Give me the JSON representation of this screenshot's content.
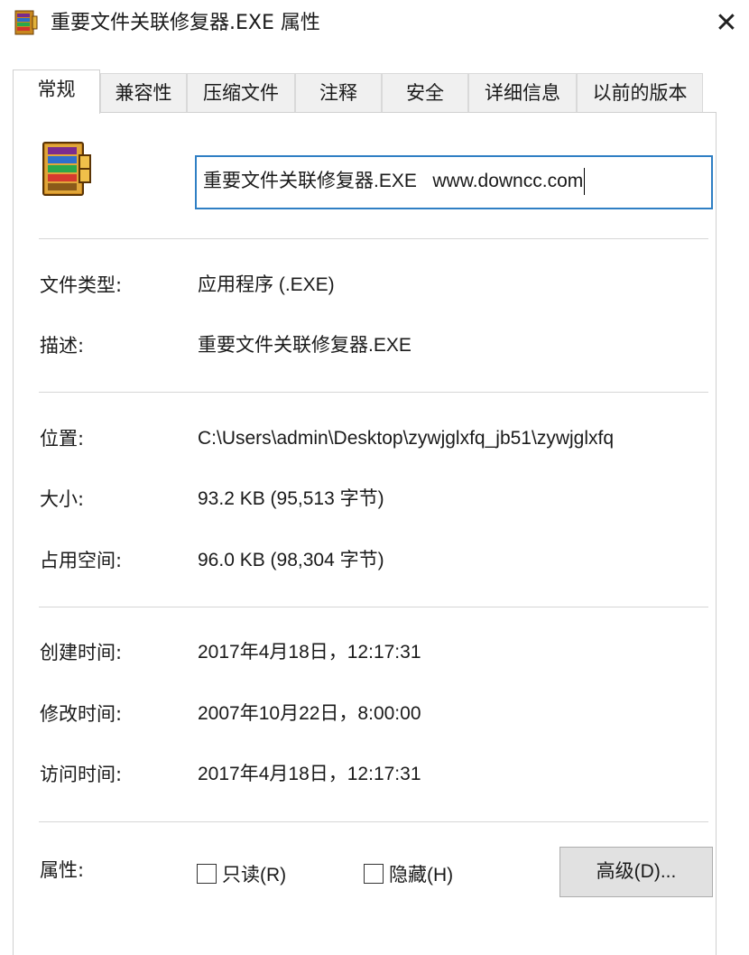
{
  "window": {
    "title": "重要文件关联修复器.EXE 属性",
    "close_glyph": "✕"
  },
  "tabs": [
    {
      "label": "常规",
      "active": true
    },
    {
      "label": "兼容性",
      "active": false
    },
    {
      "label": "压缩文件",
      "active": false
    },
    {
      "label": "注释",
      "active": false
    },
    {
      "label": "安全",
      "active": false
    },
    {
      "label": "详细信息",
      "active": false
    },
    {
      "label": "以前的版本",
      "active": false
    }
  ],
  "general": {
    "icon": "winrar-archive-icon",
    "file_name": "重要文件关联修复器.EXE   www.downcc.com",
    "file_type_label": "文件类型:",
    "file_type_value": "应用程序 (.EXE)",
    "description_label": "描述:",
    "description_value": "重要文件关联修复器.EXE",
    "location_label": "位置:",
    "location_value": "C:\\Users\\admin\\Desktop\\zywjglxfq_jb51\\zywjglxfq",
    "size_label": "大小:",
    "size_value": "93.2 KB (95,513 字节)",
    "size_on_disk_label": "占用空间:",
    "size_on_disk_value": "96.0 KB (98,304 字节)",
    "created_label": "创建时间:",
    "created_value": "2017年4月18日，12:17:31",
    "modified_label": "修改时间:",
    "modified_value": "2007年10月22日，8:00:00",
    "accessed_label": "访问时间:",
    "accessed_value": "2017年4月18日，12:17:31",
    "attributes_label": "属性:",
    "readonly_label": "只读(R)",
    "readonly_checked": false,
    "hidden_label": "隐藏(H)",
    "hidden_checked": false,
    "advanced_label": "高级(D)..."
  },
  "colors": {
    "focus_border": "#2f7fc4",
    "tab_inactive_bg": "#f0f0f0",
    "button_bg": "#e1e1e1"
  }
}
